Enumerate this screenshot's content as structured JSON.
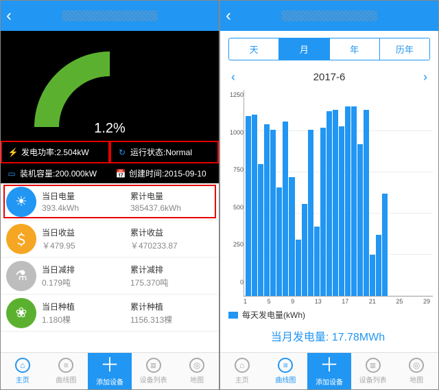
{
  "left": {
    "gauge_pct": "1.2%",
    "power_label": "发电功率:2.504kW",
    "status_label": "运行状态:Normal",
    "capacity_label": "装机容量:200.000kW",
    "created_label": "创建时间:2015-09-10",
    "rows": [
      {
        "icon": "bulb",
        "color": "#2196f3",
        "t1": "当日电量",
        "v1": "393.4kWh",
        "t2": "累计电量",
        "v2": "385437.6kWh",
        "highlight": true
      },
      {
        "icon": "coins",
        "color": "#f5a623",
        "t1": "当日收益",
        "v1": "￥479.95",
        "t2": "累计收益",
        "v2": "￥470233.87"
      },
      {
        "icon": "plant",
        "color": "#bdbdbd",
        "t1": "当日减排",
        "v1": "0.179吨",
        "t2": "累计减排",
        "v2": "175.370吨"
      },
      {
        "icon": "tree",
        "color": "#5bb12f",
        "t1": "当日种植",
        "v1": "1.180棵",
        "t2": "累计种植",
        "v2": "1156.313棵"
      }
    ]
  },
  "right": {
    "segments": [
      "天",
      "月",
      "年",
      "历年"
    ],
    "segment_selected": 1,
    "period": "2017-6",
    "legend": "每天发电量(kWh)",
    "summary_label": "当月发电量:",
    "summary_value": "17.78MWh"
  },
  "tabs": [
    {
      "id": "home",
      "label": "主页",
      "icon": "⌂"
    },
    {
      "id": "chart",
      "label": "曲线图",
      "icon": "≡"
    },
    {
      "id": "add",
      "label": "添加设备",
      "icon": "+",
      "plus": true
    },
    {
      "id": "list",
      "label": "设备列表",
      "icon": "≣"
    },
    {
      "id": "map",
      "label": "地图",
      "icon": "◎"
    }
  ],
  "chart_data": {
    "type": "bar",
    "title": "每天发电量(kWh)",
    "xlabel": "",
    "ylabel": "",
    "ylim": [
      0,
      1250
    ],
    "x_ticks": [
      1,
      5,
      9,
      13,
      17,
      21,
      25,
      29
    ],
    "y_ticks": [
      0,
      250,
      500,
      750,
      1000,
      1250
    ],
    "categories": [
      1,
      2,
      3,
      4,
      5,
      6,
      7,
      8,
      9,
      10,
      11,
      12,
      13,
      14,
      15,
      16,
      17,
      18,
      19,
      20,
      21,
      22,
      23
    ],
    "values": [
      1090,
      1100,
      800,
      1040,
      1010,
      660,
      1060,
      720,
      340,
      560,
      1010,
      420,
      1020,
      1120,
      1130,
      1030,
      1150,
      1150,
      920,
      1130,
      250,
      370,
      620
    ]
  }
}
